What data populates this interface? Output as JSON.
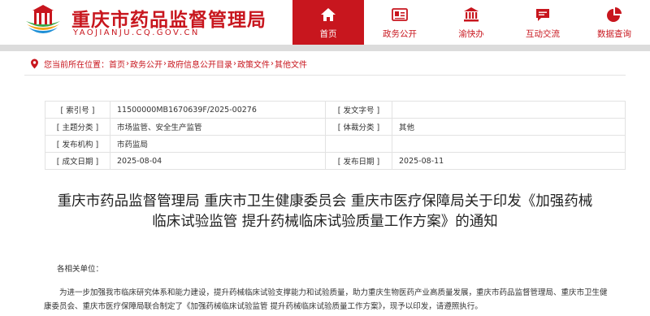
{
  "header": {
    "site_title": "重庆市药品监督管理局",
    "site_domain": "YAOJIANJU.CQ.GOV.CN",
    "brand_color": "#c8161e"
  },
  "nav": {
    "items": [
      {
        "label": "首页",
        "icon": "home-icon",
        "active": true
      },
      {
        "label": "政务公开",
        "icon": "id-card-icon",
        "active": false
      },
      {
        "label": "渝快办",
        "icon": "government-building-icon",
        "active": false
      },
      {
        "label": "互动交流",
        "icon": "chat-bubble-icon",
        "active": false
      },
      {
        "label": "数据查询",
        "icon": "pie-chart-icon",
        "active": false
      }
    ]
  },
  "breadcrumb": {
    "prefix": "您当前所在位置：",
    "items": [
      "首页",
      "政务公开",
      "政府信息公开目录",
      "政策文件",
      "其他文件"
    ],
    "separator": "›"
  },
  "info_table": {
    "rows": [
      {
        "k1": "[ 索引号 ]",
        "v1": "11500000MB1670639F/2025-00276",
        "k2": "[ 发文字号 ]",
        "v2": ""
      },
      {
        "k1": "[ 主题分类 ]",
        "v1": "市场监管、安全生产监管",
        "k2": "[ 体裁分类 ]",
        "v2": "其他"
      },
      {
        "k1": "[ 发布机构 ]",
        "v1": "市药监局",
        "k2": "",
        "v2": ""
      },
      {
        "k1": "[ 成文日期 ]",
        "v1": "2025-08-04",
        "k2": "[ 发布日期 ]",
        "v2": "2025-08-11"
      }
    ]
  },
  "document": {
    "title_line1": "重庆市药品监督管理局 重庆市卫生健康委员会 重庆市医疗保障局关于印发《加强药械",
    "title_line2": "临床试验监管 提升药械临床试验质量工作方案》的通知",
    "salutation": "各相关单位：",
    "paragraph1": "为进一步加强我市临床研究体系和能力建设，提升药械临床试验支撑能力和试验质量，助力重庆生物医药产业高质量发展，重庆市药品监督管理局、重庆市卫生健康委员会、重庆市医疗保障局联合制定了《加强药械临床试验监管 提升药械临床试验质量工作方案》，现予以印发，请遵照执行。"
  }
}
